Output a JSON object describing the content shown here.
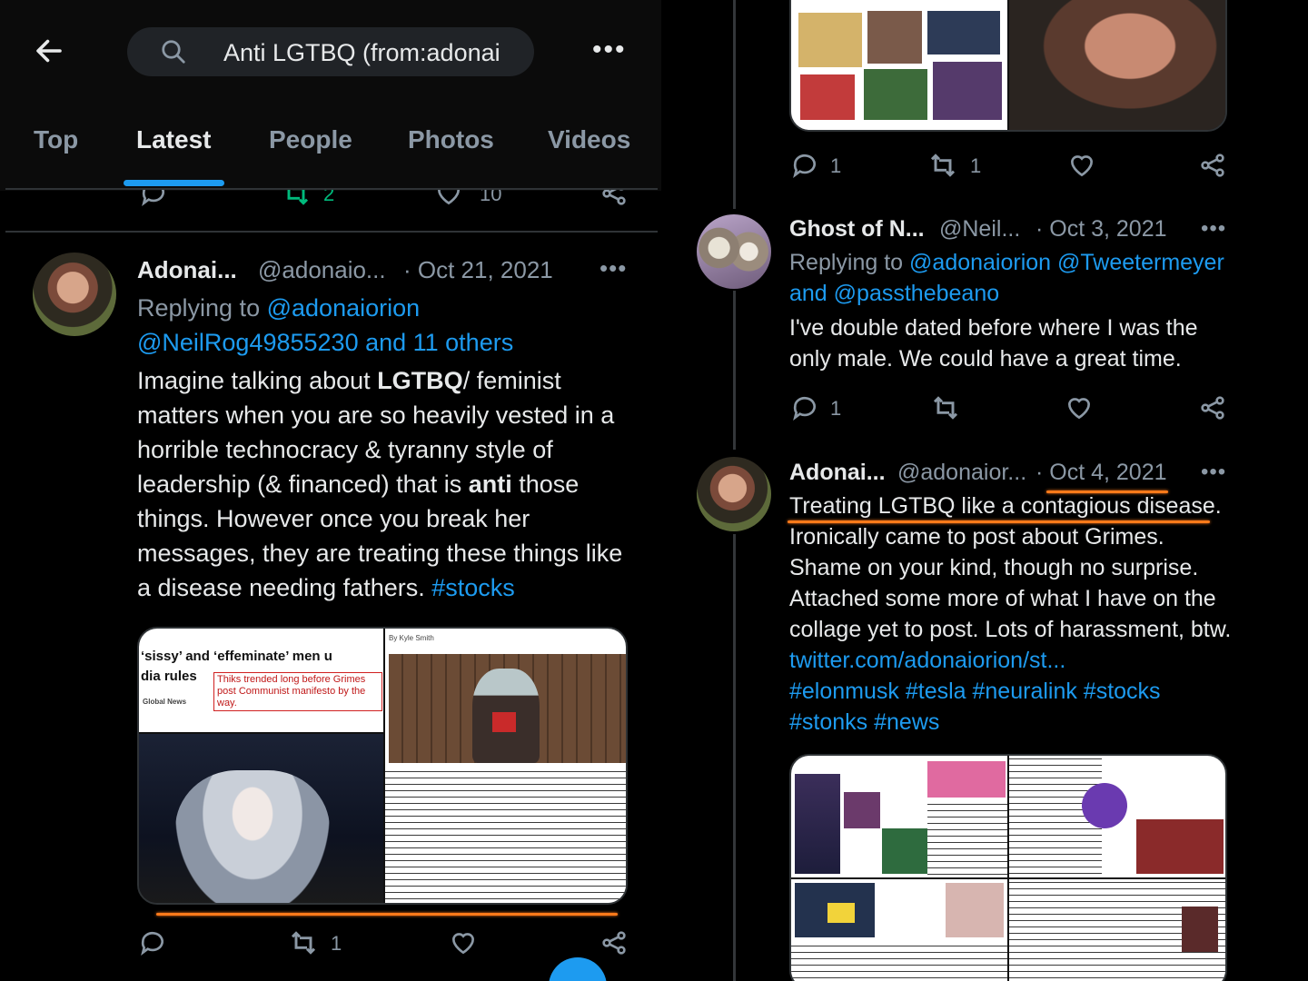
{
  "search": {
    "query": "Anti LGTBQ (from:adonai"
  },
  "tabs": [
    {
      "label": "Top"
    },
    {
      "label": "Latest"
    },
    {
      "label": "People"
    },
    {
      "label": "Photos"
    },
    {
      "label": "Videos"
    }
  ],
  "active_tab": "Latest",
  "prev_tweet_actions": {
    "retweets": "2",
    "likes": "10"
  },
  "tweet_left": {
    "display_name": "Adonai...",
    "handle": "@adonaio...",
    "date": "· Oct 21, 2021",
    "replying_prefix": "Replying to",
    "reply_to_1": "@adonaiorion",
    "reply_to_2": "@NeilRog49855230 and 11 others",
    "body": {
      "t1": "Imagine talking about ",
      "b1": "LGTBQ",
      "t2": "/ feminist matters when you are so heavily vested in a horrible technocracy & tyranny style of leadership (& financed) that is ",
      "b2": "anti",
      "t3": " those things. However once you break her messages, they are treating these things like a disease needing fathers. ",
      "hashtag": "#stocks"
    },
    "media": {
      "headline_1": "‘sissy’ and ‘effeminate’ men u",
      "headline_2": "dia rules",
      "note": "Thiks trended long before Grimes post Communist manifesto by the way.",
      "source": "Global News",
      "byline": "By Kyle Smith"
    },
    "actions": {
      "retweets": "1"
    }
  },
  "tweet_top_right": {
    "actions": {
      "replies": "1",
      "retweets": "1"
    }
  },
  "tweet_ghost": {
    "display_name": "Ghost of N...",
    "handle": "@Neil...",
    "date": "· Oct 3, 2021",
    "replying_prefix": "Replying to",
    "reply_to_1": "@adonaiorion @Tweetermeyer",
    "reply_and": "and",
    "reply_to_2": "@passthebeano",
    "body": "I've double dated before where I was the only male. We could have a great time.",
    "actions": {
      "replies": "1"
    }
  },
  "tweet_oct4": {
    "display_name": "Adonai...",
    "handle": "@adonaior...",
    "date": "· Oct 4, 2021",
    "line1": "Treating LGTBQ like a contagious disease.",
    "body": "Ironically came to post about Grimes. Shame on your kind, though no surprise. Attached some more of what I have on the collage yet to post. Lots of harassment, btw.",
    "link": "twitter.com/adonaiorion/st...",
    "hashtags_1": "#elonmusk #tesla #neuralink #stocks",
    "hashtags_2": "#stonks #news"
  },
  "colors": {
    "accent": "#1d9bf0",
    "retweeted": "#00ba7c",
    "highlight": "#ff7a1a",
    "bg": "#000000",
    "muted": "#8b98a5"
  }
}
